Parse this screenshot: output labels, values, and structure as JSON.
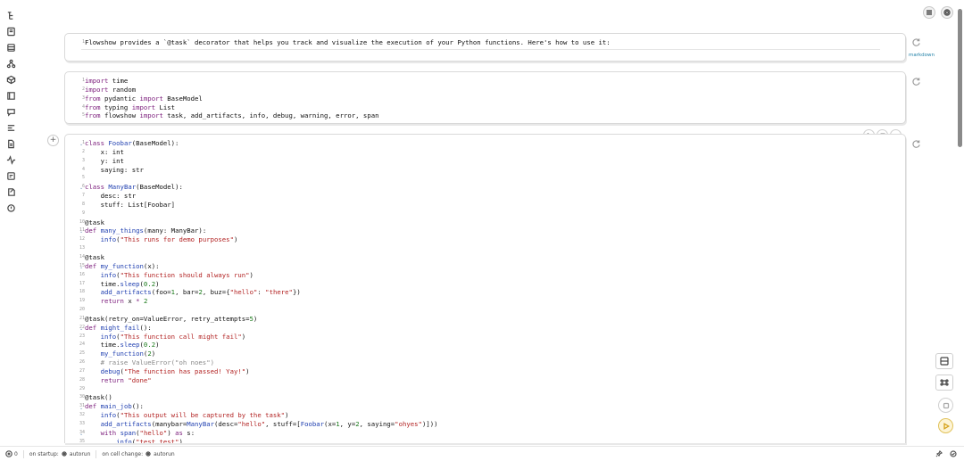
{
  "markdown_cell": {
    "line_numbers": [
      "1"
    ],
    "text": "Flowshow provides a `@task` decorator that helps you track and visualize the execution of your Python functions. Here's how to use it:",
    "badge": "markdown"
  },
  "imports_cell": {
    "line_numbers": [
      "1",
      "2",
      "3",
      "4",
      "5"
    ]
  },
  "main_cell": {
    "line_numbers": [
      "1",
      "2",
      "3",
      "4",
      "5",
      "6",
      "7",
      "8",
      "9",
      "10",
      "11",
      "12",
      "13",
      "14",
      "15",
      "16",
      "17",
      "18",
      "19",
      "20",
      "21",
      "22",
      "23",
      "24",
      "25",
      "26",
      "27",
      "28",
      "29",
      "30",
      "31",
      "32",
      "33",
      "34",
      "35"
    ]
  },
  "footer": {
    "error_count": "0",
    "on_startup_label": "on startup:",
    "on_startup_value": "autorun",
    "on_cell_change_label": "on cell change:",
    "on_cell_change_value": "autorun"
  },
  "colors": {
    "accent_run": "#d4a017",
    "badge": "#1e7fa6"
  }
}
